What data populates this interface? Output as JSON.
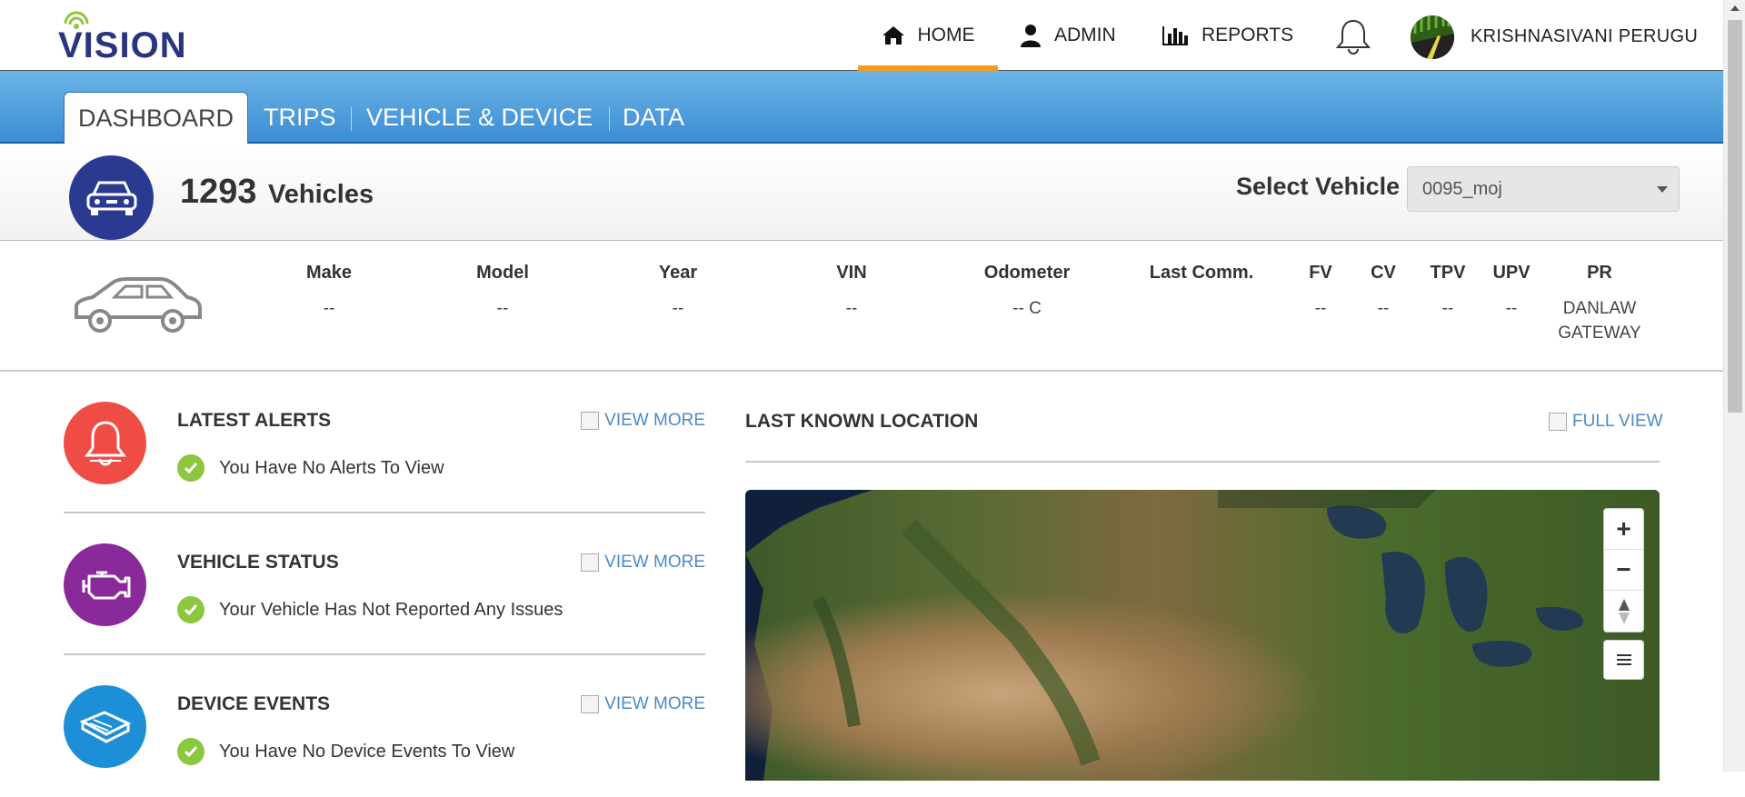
{
  "header": {
    "logo_text": "VISION",
    "nav": [
      {
        "label": "HOME",
        "icon": "home-icon",
        "active": true
      },
      {
        "label": "ADMIN",
        "icon": "user-icon"
      },
      {
        "label": "REPORTS",
        "icon": "bar-chart-icon"
      }
    ],
    "bell_icon": "bell-icon",
    "username": "KRISHNASIVANI PERUGU"
  },
  "tabs": [
    {
      "label": "DASHBOARD",
      "active": true
    },
    {
      "label": "TRIPS"
    },
    {
      "label": "VEHICLE & DEVICE"
    },
    {
      "label": "DATA"
    }
  ],
  "summary": {
    "count": "1293",
    "count_label": "Vehicles",
    "select_label": "Select Vehicle",
    "selected_vehicle": "0095_moj"
  },
  "vehicle_info": {
    "columns": [
      {
        "header": "Make",
        "value": "--"
      },
      {
        "header": "Model",
        "value": "--"
      },
      {
        "header": "Year",
        "value": "--"
      },
      {
        "header": "VIN",
        "value": "--"
      },
      {
        "header": "Odometer",
        "value": "-- C"
      },
      {
        "header": "Last Comm.",
        "value": ""
      },
      {
        "header": "FV",
        "value": "--"
      },
      {
        "header": "CV",
        "value": "--"
      },
      {
        "header": "TPV",
        "value": "--"
      },
      {
        "header": "UPV",
        "value": "--"
      },
      {
        "header": "PR",
        "value": "DANLAW",
        "value2": "GATEWAY"
      }
    ]
  },
  "sections": [
    {
      "title": "LATEST ALERTS",
      "more": "VIEW MORE",
      "message": "You Have No Alerts To View",
      "color": "#ef4c45",
      "icon": "bell-icon"
    },
    {
      "title": "VEHICLE STATUS",
      "more": "VIEW MORE",
      "message": "Your Vehicle Has Not Reported Any Issues",
      "color": "#8a2a9a",
      "icon": "engine-icon"
    },
    {
      "title": "DEVICE EVENTS",
      "more": "VIEW MORE",
      "message": "You Have No Device Events To View",
      "color": "#1c8fd6",
      "icon": "device-icon"
    }
  ],
  "map": {
    "title": "LAST KNOWN LOCATION",
    "full_view": "FULL VIEW",
    "controls": [
      "+",
      "−"
    ]
  },
  "colors": {
    "accent_orange": "#f49b1d",
    "tab_blue": "#3d8dd4",
    "brand_navy": "#2a3580",
    "link_blue": "#4a8ac8",
    "check_green": "#8dc63f"
  }
}
